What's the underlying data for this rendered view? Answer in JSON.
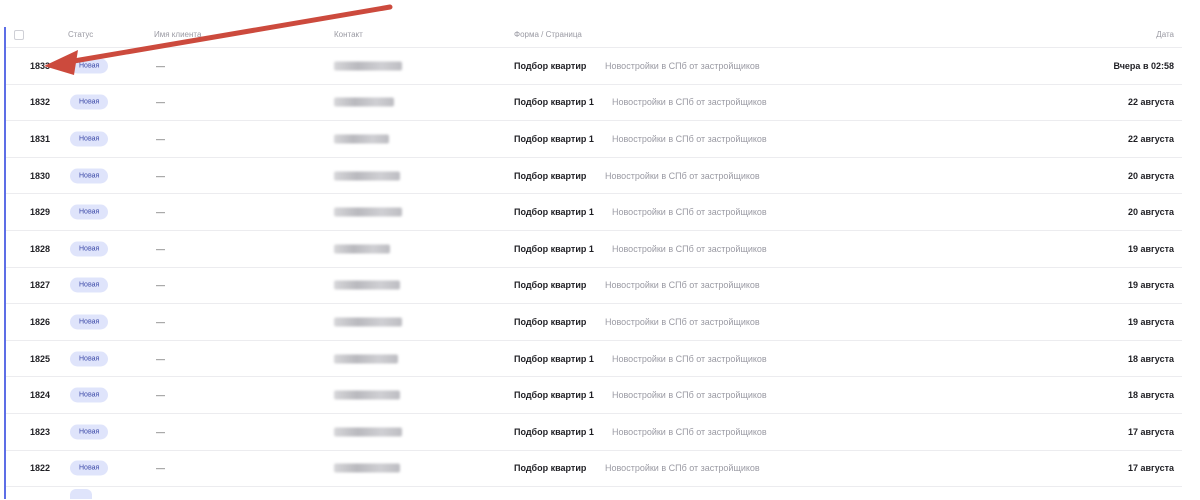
{
  "header": {
    "status": "Статус",
    "name": "Имя клиента",
    "contact": "Контакт",
    "form_page": "Форма / Страница",
    "date": "Дата"
  },
  "rows": [
    {
      "id": "1833",
      "status": "Новая",
      "name": "—",
      "form": "Подбор квартир",
      "page": "Новостройки в СПб от застройщиков",
      "date": "Вчера в 02:58"
    },
    {
      "id": "1832",
      "status": "Новая",
      "name": "—",
      "form": "Подбор квартир 1",
      "page": "Новостройки в СПб от застройщиков",
      "date": "22 августа"
    },
    {
      "id": "1831",
      "status": "Новая",
      "name": "—",
      "form": "Подбор квартир 1",
      "page": "Новостройки в СПб от застройщиков",
      "date": "22 августа"
    },
    {
      "id": "1830",
      "status": "Новая",
      "name": "—",
      "form": "Подбор квартир",
      "page": "Новостройки в СПб от застройщиков",
      "date": "20 августа"
    },
    {
      "id": "1829",
      "status": "Новая",
      "name": "—",
      "form": "Подбор квартир 1",
      "page": "Новостройки в СПб от застройщиков",
      "date": "20 августа"
    },
    {
      "id": "1828",
      "status": "Новая",
      "name": "—",
      "form": "Подбор квартир 1",
      "page": "Новостройки в СПб от застройщиков",
      "date": "19 августа"
    },
    {
      "id": "1827",
      "status": "Новая",
      "name": "—",
      "form": "Подбор квартир",
      "page": "Новостройки в СПб от застройщиков",
      "date": "19 августа"
    },
    {
      "id": "1826",
      "status": "Новая",
      "name": "—",
      "form": "Подбор квартир",
      "page": "Новостройки в СПб от застройщиков",
      "date": "19 августа"
    },
    {
      "id": "1825",
      "status": "Новая",
      "name": "—",
      "form": "Подбор квартир 1",
      "page": "Новостройки в СПб от застройщиков",
      "date": "18 августа"
    },
    {
      "id": "1824",
      "status": "Новая",
      "name": "—",
      "form": "Подбор квартир 1",
      "page": "Новостройки в СПб от застройщиков",
      "date": "18 августа"
    },
    {
      "id": "1823",
      "status": "Новая",
      "name": "—",
      "form": "Подбор квартир 1",
      "page": "Новостройки в СПб от застройщиков",
      "date": "17 августа"
    },
    {
      "id": "1822",
      "status": "Новая",
      "name": "—",
      "form": "Подбор квартир",
      "page": "Новостройки в СПб от застройщиков",
      "date": "17 августа"
    }
  ],
  "colors": {
    "accent": "#5d6ee6",
    "badge_bg": "#dfe4fb",
    "badge_text": "#3c4aa8",
    "annotation_arrow": "#cc4a3d"
  },
  "icons": {
    "select_all": "checkbox-icon",
    "annotation": "red-arrow-icon"
  }
}
